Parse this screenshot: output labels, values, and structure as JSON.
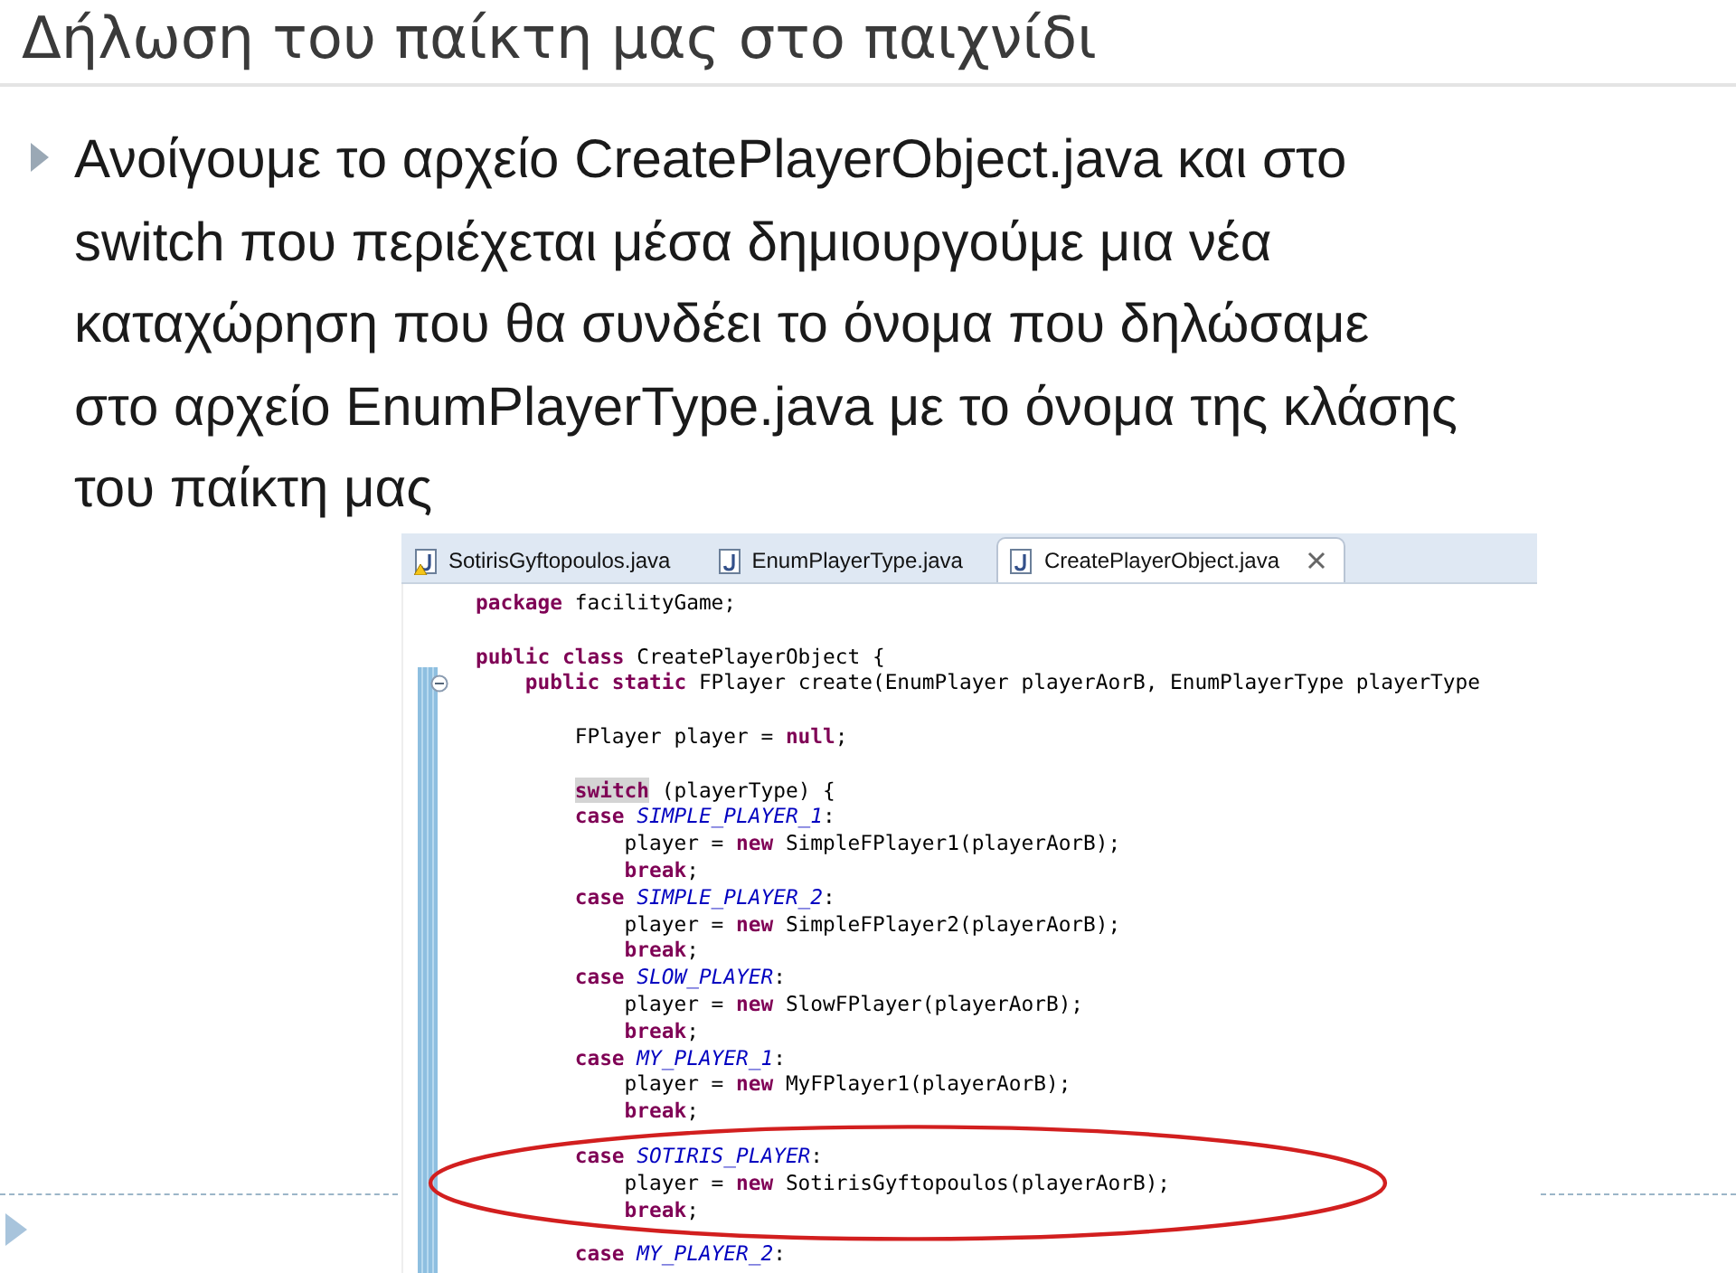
{
  "slide": {
    "title": "Δήλωση του παίκτη μας στο παιχνίδι",
    "bullet": {
      "lines": [
        "Ανοίγουμε το αρχείο CreatePlayerObject.java και στο",
        "switch που περιέχεται μέσα δημιουργούμε μια νέα",
        "καταχώρηση που θα συνδέει το όνομα που δηλώσαμε",
        "στο αρχείο EnumPlayerType.java με το όνομα της κλάσης",
        "του παίκτη μας"
      ]
    }
  },
  "editor": {
    "tabs": [
      {
        "label": "SotirisGyftopoulos.java",
        "selected": false,
        "warning": true
      },
      {
        "label": "EnumPlayerType.java",
        "selected": false,
        "warning": false
      },
      {
        "label": "CreatePlayerObject.java",
        "selected": true,
        "warning": false
      }
    ],
    "lines": [
      {
        "kind": "code",
        "circled": false,
        "tokens": [
          {
            "kind": "keyword",
            "text": "package"
          },
          {
            "kind": "plain",
            "text": " facilityGame;"
          }
        ]
      },
      {
        "kind": "blank"
      },
      {
        "kind": "code",
        "circled": false,
        "tokens": [
          {
            "kind": "keyword",
            "text": "public class"
          },
          {
            "kind": "plain",
            "text": " CreatePlayerObject {"
          }
        ]
      },
      {
        "kind": "code",
        "circled": false,
        "folded": false,
        "tokens": [
          {
            "kind": "keyword",
            "text": "    public static"
          },
          {
            "kind": "plain",
            "text": " FPlayer create(EnumPlayer playerAorB, EnumPlayerType playerType"
          }
        ]
      },
      {
        "kind": "blank"
      },
      {
        "kind": "code",
        "circled": false,
        "tokens": [
          {
            "kind": "plain",
            "text": "        FPlayer player = "
          },
          {
            "kind": "keyword",
            "text": "null"
          },
          {
            "kind": "plain",
            "text": ";"
          }
        ]
      },
      {
        "kind": "blank"
      },
      {
        "kind": "code",
        "circled": false,
        "tokens": [
          {
            "kind": "keyword",
            "text": "        switch",
            "highlighted": true
          },
          {
            "kind": "plain",
            "text": " (playerType) {"
          }
        ]
      },
      {
        "kind": "code",
        "circled": false,
        "tokens": [
          {
            "kind": "keyword",
            "text": "        case "
          },
          {
            "kind": "constant",
            "text": "SIMPLE_PLAYER_1"
          },
          {
            "kind": "plain",
            "text": ":"
          }
        ]
      },
      {
        "kind": "code",
        "circled": false,
        "tokens": [
          {
            "kind": "plain",
            "text": "            player = "
          },
          {
            "kind": "keyword",
            "text": "new"
          },
          {
            "kind": "plain",
            "text": " SimpleFPlayer1(playerAorB);"
          }
        ]
      },
      {
        "kind": "code",
        "circled": false,
        "tokens": [
          {
            "kind": "keyword",
            "text": "            break"
          },
          {
            "kind": "plain",
            "text": ";"
          }
        ]
      },
      {
        "kind": "code",
        "circled": false,
        "tokens": [
          {
            "kind": "keyword",
            "text": "        case "
          },
          {
            "kind": "constant",
            "text": "SIMPLE_PLAYER_2"
          },
          {
            "kind": "plain",
            "text": ":"
          }
        ]
      },
      {
        "kind": "code",
        "circled": false,
        "tokens": [
          {
            "kind": "plain",
            "text": "            player = "
          },
          {
            "kind": "keyword",
            "text": "new"
          },
          {
            "kind": "plain",
            "text": " SimpleFPlayer2(playerAorB);"
          }
        ]
      },
      {
        "kind": "code",
        "circled": false,
        "tokens": [
          {
            "kind": "keyword",
            "text": "            break"
          },
          {
            "kind": "plain",
            "text": ";"
          }
        ]
      },
      {
        "kind": "code",
        "circled": false,
        "tokens": [
          {
            "kind": "keyword",
            "text": "        case "
          },
          {
            "kind": "constant",
            "text": "SLOW_PLAYER"
          },
          {
            "kind": "plain",
            "text": ":"
          }
        ]
      },
      {
        "kind": "code",
        "circled": false,
        "tokens": [
          {
            "kind": "plain",
            "text": "            player = "
          },
          {
            "kind": "keyword",
            "text": "new"
          },
          {
            "kind": "plain",
            "text": " SlowFPlayer(playerAorB);"
          }
        ]
      },
      {
        "kind": "code",
        "circled": false,
        "tokens": [
          {
            "kind": "keyword",
            "text": "            break"
          },
          {
            "kind": "plain",
            "text": ";"
          }
        ]
      },
      {
        "kind": "code",
        "circled": false,
        "tokens": [
          {
            "kind": "keyword",
            "text": "        case "
          },
          {
            "kind": "constant",
            "text": "MY_PLAYER_1"
          },
          {
            "kind": "plain",
            "text": ":"
          }
        ]
      },
      {
        "kind": "code",
        "circled": false,
        "tokens": [
          {
            "kind": "plain",
            "text": "            player = "
          },
          {
            "kind": "keyword",
            "text": "new"
          },
          {
            "kind": "plain",
            "text": " MyFPlayer1(playerAorB);"
          }
        ]
      },
      {
        "kind": "code",
        "circled": false,
        "tokens": [
          {
            "kind": "keyword",
            "text": "            break"
          },
          {
            "kind": "plain",
            "text": ";"
          }
        ]
      },
      {
        "kind": "code",
        "circled": true,
        "tokens": [
          {
            "kind": "keyword",
            "text": "        case "
          },
          {
            "kind": "constant",
            "text": "SOTIRIS_PLAYER"
          },
          {
            "kind": "plain",
            "text": ":"
          }
        ]
      },
      {
        "kind": "code",
        "circled": true,
        "tokens": [
          {
            "kind": "plain",
            "text": "            player = "
          },
          {
            "kind": "keyword",
            "text": "new"
          },
          {
            "kind": "plain",
            "text": " SotirisGyftopoulos(playerAorB);"
          }
        ]
      },
      {
        "kind": "code",
        "circled": true,
        "tokens": [
          {
            "kind": "keyword",
            "text": "            break"
          },
          {
            "kind": "plain",
            "text": ";"
          }
        ]
      },
      {
        "kind": "code",
        "circled": false,
        "tokens": [
          {
            "kind": "keyword",
            "text": "        case "
          },
          {
            "kind": "constant",
            "text": "MY_PLAYER_2"
          },
          {
            "kind": "plain",
            "text": ":"
          }
        ]
      }
    ]
  }
}
